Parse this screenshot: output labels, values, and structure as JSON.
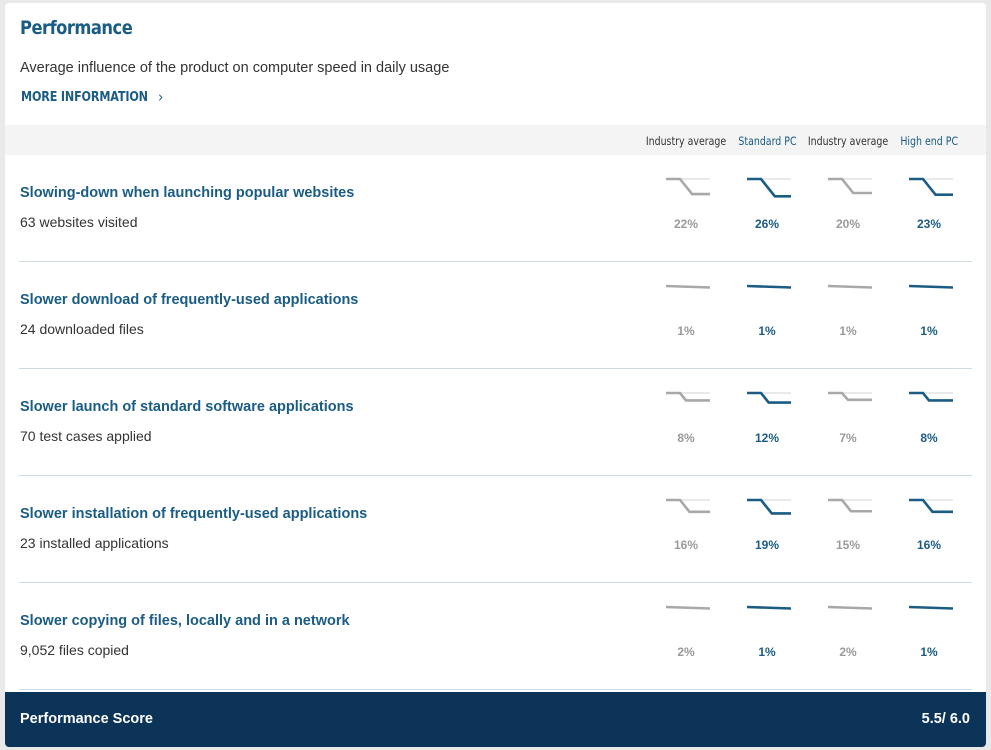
{
  "header": {
    "title": "Performance",
    "subtitle": "Average influence of the product on computer speed in daily usage",
    "more_link": "MORE INFORMATION",
    "more_chevron": "›"
  },
  "columns": [
    {
      "label": "Industry average",
      "style": "grey"
    },
    {
      "label": "Standard PC",
      "style": "blue"
    },
    {
      "label": "Industry average",
      "style": "grey"
    },
    {
      "label": "High end PC",
      "style": "blue"
    }
  ],
  "rows": [
    {
      "name": "Slowing-down when launching popular websites",
      "detail": "63 websites visited",
      "values": [
        "22%",
        "26%",
        "20%",
        "23%"
      ]
    },
    {
      "name": "Slower download of frequently-used applications",
      "detail": "24 downloaded files",
      "values": [
        "1%",
        "1%",
        "1%",
        "1%"
      ]
    },
    {
      "name": "Slower launch of standard software applications",
      "detail": "70 test cases applied",
      "values": [
        "8%",
        "12%",
        "7%",
        "8%"
      ]
    },
    {
      "name": "Slower installation of frequently-used applications",
      "detail": "23 installed applications",
      "values": [
        "16%",
        "19%",
        "15%",
        "16%"
      ]
    },
    {
      "name": "Slower copying of files, locally and in a network",
      "detail": "9,052 files copied",
      "values": [
        "2%",
        "1%",
        "2%",
        "1%"
      ]
    }
  ],
  "footer": {
    "label": "Performance Score",
    "score": "5.5/ 6.0"
  },
  "colors": {
    "accent": "#1a5c84",
    "grey": "#a8a8a8",
    "footer_bg": "#0c3358",
    "track": "#dcdcdc"
  }
}
